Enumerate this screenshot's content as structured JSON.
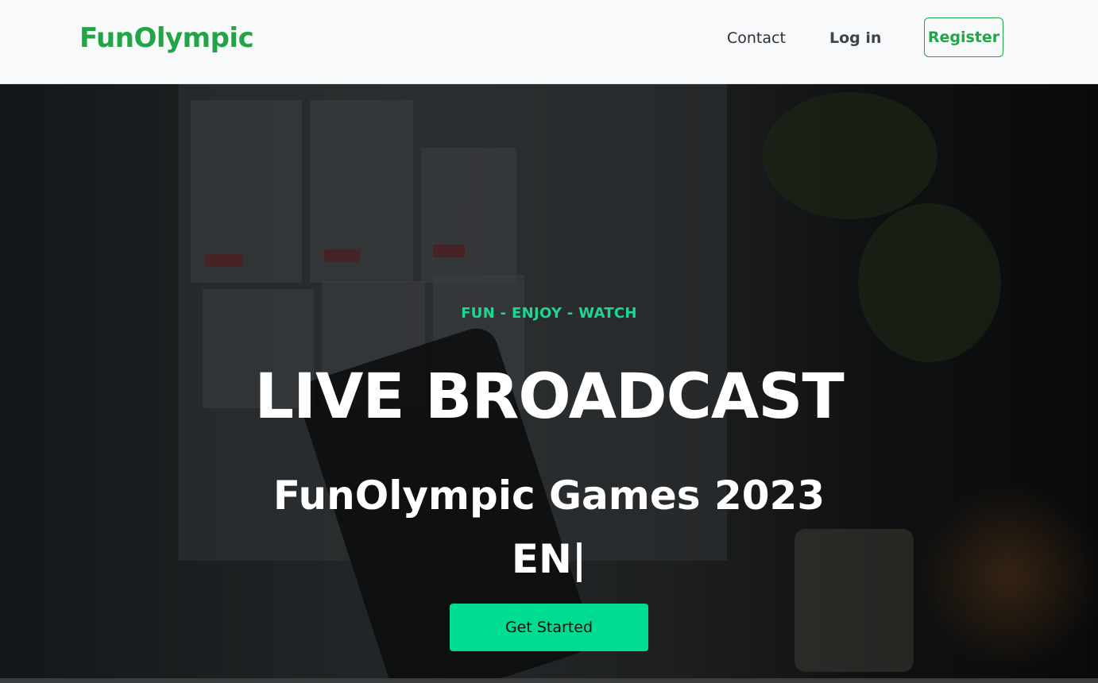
{
  "nav": {
    "brand": "FunOlympic",
    "contact": "Contact",
    "login": "Log in",
    "register": "Register"
  },
  "hero": {
    "tagline": "FUN - ENJOY - WATCH",
    "headline": "LIVE BROADCAST",
    "subheadline": "FunOlympic Games 2023",
    "typed_text": "EN|",
    "cta": "Get Started"
  },
  "colors": {
    "brand_green": "#22a447",
    "accent_teal": "#00dc92",
    "tagline_green": "#1fd68f",
    "navbar_bg": "#f8f9fa"
  }
}
